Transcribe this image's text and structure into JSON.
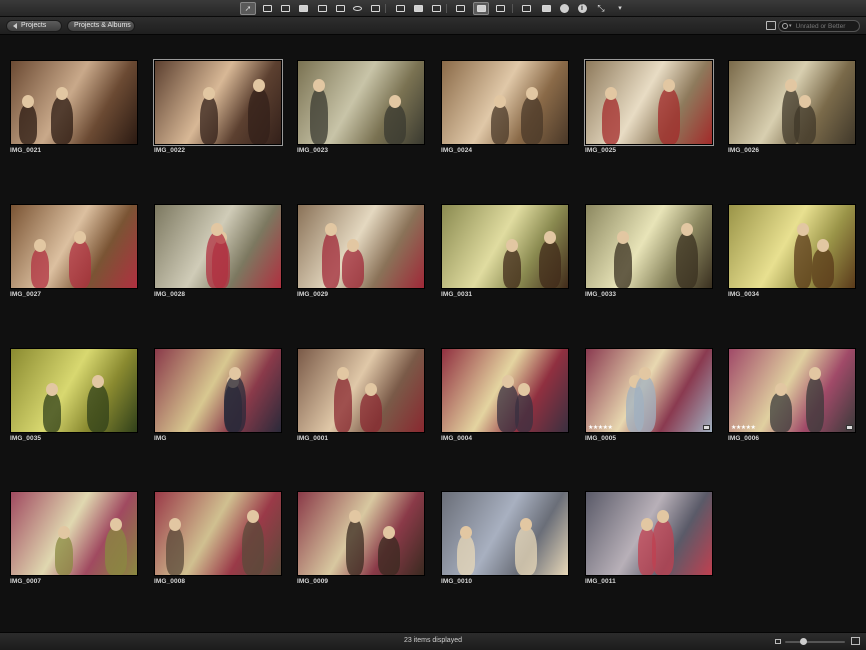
{
  "toolbar": {
    "tools": [
      {
        "icon": "pointer-icon",
        "active": true
      },
      {
        "icon": "lift-tool-icon"
      },
      {
        "icon": "stamp-tool-icon"
      },
      {
        "icon": "stack-icon"
      },
      {
        "icon": "rotate-icon"
      },
      {
        "icon": "crop-icon"
      },
      {
        "icon": "red-eye-icon"
      },
      {
        "icon": "brush-icon"
      },
      {
        "icon": "viewer-icon"
      },
      {
        "icon": "split-view-icon"
      },
      {
        "icon": "browser-icon"
      },
      {
        "icon": "filmstrip-icon"
      },
      {
        "icon": "grid-view-icon",
        "active": true
      },
      {
        "icon": "list-view-icon"
      },
      {
        "icon": "loupe-icon"
      },
      {
        "icon": "tag-icon"
      },
      {
        "icon": "adjustments-icon"
      },
      {
        "icon": "info-icon"
      },
      {
        "icon": "fullscreen-icon"
      },
      {
        "icon": "overflow-icon"
      }
    ]
  },
  "subbar": {
    "projects_label": "Projects",
    "projects_albums_label": "Projects & Albums",
    "filter_placeholder": "Unrated or Better"
  },
  "photos": [
    {
      "name": "IMG_0021",
      "palette": [
        "#6b4a33",
        "#c9a98a",
        "#2b1a12"
      ]
    },
    {
      "name": "IMG_0022",
      "palette": [
        "#5c4030",
        "#d8b896",
        "#33201a"
      ],
      "selected": true
    },
    {
      "name": "IMG_0023",
      "palette": [
        "#7a7252",
        "#c8c4a8",
        "#3a3a30"
      ]
    },
    {
      "name": "IMG_0024",
      "palette": [
        "#8a6a48",
        "#e0c8a8",
        "#4a3828"
      ]
    },
    {
      "name": "IMG_0025",
      "palette": [
        "#8e7a5c",
        "#e8dcc4",
        "#a32a2a"
      ],
      "selected": true
    },
    {
      "name": "IMG_0026",
      "palette": [
        "#7a6a4a",
        "#d8cfb0",
        "#40382a"
      ]
    },
    {
      "name": "IMG_0027",
      "palette": [
        "#7a5434",
        "#dcc0a0",
        "#b03040"
      ]
    },
    {
      "name": "IMG_0028",
      "palette": [
        "#7c7860",
        "#d0ccb8",
        "#b03040"
      ]
    },
    {
      "name": "IMG_0029",
      "palette": [
        "#8a7258",
        "#e4d8c0",
        "#a02838"
      ]
    },
    {
      "name": "IMG_0031",
      "palette": [
        "#8a8a50",
        "#e0dca0",
        "#402a1a"
      ]
    },
    {
      "name": "IMG_0033",
      "palette": [
        "#8c8860",
        "#e8e4b8",
        "#3a3020"
      ]
    },
    {
      "name": "IMG_0034",
      "palette": [
        "#9a9448",
        "#e8e090",
        "#5a3a1a"
      ]
    },
    {
      "name": "IMG_0035",
      "palette": [
        "#8a8a30",
        "#d8d870",
        "#30401a"
      ]
    },
    {
      "name": "IMG",
      "palette": [
        "#8a3a4a",
        "#d8c890",
        "#2a2a3a"
      ]
    },
    {
      "name": "IMG_0001",
      "palette": [
        "#7a5a48",
        "#e0c8a8",
        "#8a2830"
      ]
    },
    {
      "name": "IMG_0004",
      "palette": [
        "#903040",
        "#e4d4a0",
        "#3a3040"
      ]
    },
    {
      "name": "IMG_0005",
      "palette": [
        "#8a3a50",
        "#e8d8b0",
        "#a0b0c0"
      ],
      "stars": "★★★★★",
      "badge": true
    },
    {
      "name": "IMG_0006",
      "palette": [
        "#a04a68",
        "#e0d0a0",
        "#3a3a3a"
      ],
      "stars": "★★★★★",
      "badge": true
    },
    {
      "name": "IMG_0007",
      "palette": [
        "#a04a60",
        "#e0d8b0",
        "#8a8a40"
      ]
    },
    {
      "name": "IMG_0008",
      "palette": [
        "#9a3a48",
        "#d0c090",
        "#5a4a3a"
      ]
    },
    {
      "name": "IMG_0009",
      "palette": [
        "#8a3a48",
        "#d8c8a0",
        "#3a2a20"
      ]
    },
    {
      "name": "IMG_0010",
      "palette": [
        "#6a6e78",
        "#a8b0c0",
        "#e8d8b8"
      ]
    },
    {
      "name": "IMG_0011",
      "palette": [
        "#5a5a68",
        "#b8b0b8",
        "#c04050"
      ]
    }
  ],
  "status": {
    "text": "23 items displayed"
  }
}
